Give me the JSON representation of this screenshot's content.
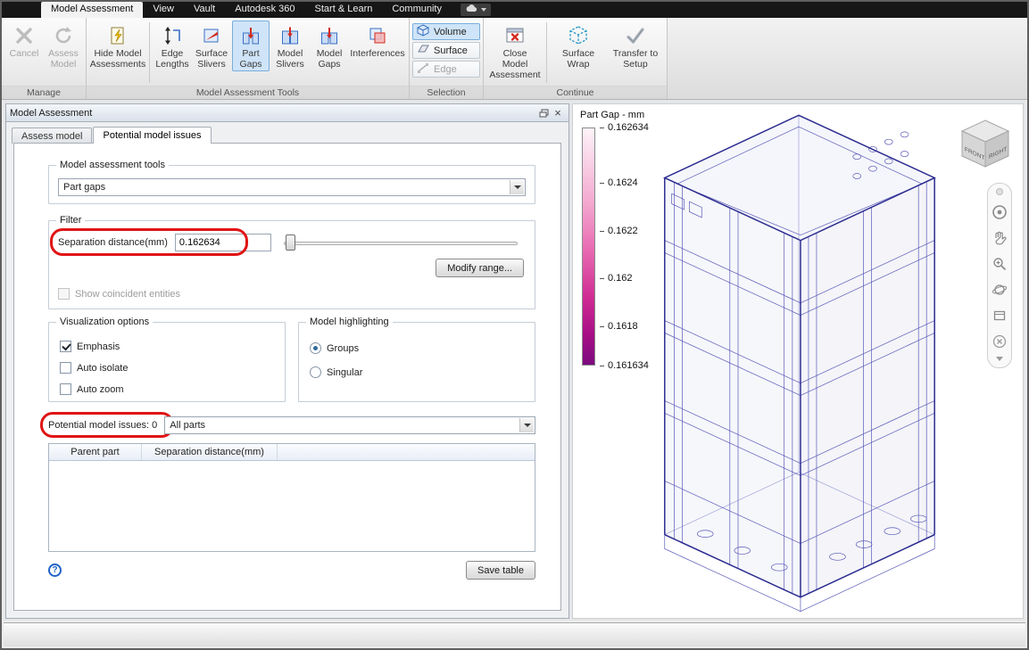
{
  "menubar": {
    "tabs": [
      "Model Assessment",
      "View",
      "Vault",
      "Autodesk 360",
      "Start & Learn",
      "Community"
    ]
  },
  "ribbon": {
    "group_labels": {
      "manage": "Manage",
      "tools": "Model Assessment Tools",
      "selection": "Selection",
      "continue": "Continue"
    },
    "buttons": {
      "cancel": "Cancel",
      "assess_model": "Assess Model",
      "hide_model_assessments": "Hide Model Assessments",
      "edge_lengths": "Edge Lengths",
      "surface_slivers": "Surface Slivers",
      "part_gaps": "Part Gaps",
      "model_slivers": "Model Slivers",
      "model_gaps": "Model Gaps",
      "interferences": "Interferences",
      "volume": "Volume",
      "surface": "Surface",
      "edge": "Edge",
      "close_model_assessment": "Close Model Assessment",
      "surface_wrap": "Surface Wrap",
      "transfer_to_setup": "Transfer to Setup"
    }
  },
  "panel": {
    "title": "Model Assessment",
    "tabs": [
      "Assess model",
      "Potential model issues"
    ],
    "tools": {
      "label": "Model assessment tools",
      "value": "Part gaps"
    },
    "filter": {
      "label": "Filter",
      "separation_label": "Separation distance(mm)",
      "separation_value": "0.162634",
      "modify_range_button": "Modify range...",
      "show_coincident_label": "Show coincident entities"
    },
    "visualization": {
      "label": "Visualization options",
      "options": [
        {
          "label": "Emphasis",
          "checked": true
        },
        {
          "label": "Auto isolate",
          "checked": false
        },
        {
          "label": "Auto zoom",
          "checked": false
        }
      ]
    },
    "highlighting": {
      "label": "Model highlighting",
      "options": [
        {
          "label": "Groups",
          "selected": true
        },
        {
          "label": "Singular",
          "selected": false
        }
      ]
    },
    "issues": {
      "label": "Potential model issues: 0",
      "dropdown_value": "All parts"
    },
    "table": {
      "headers": [
        "Parent part",
        "Separation distance(mm)"
      ]
    },
    "save_table_button": "Save table",
    "help_glyph": "?"
  },
  "viewport": {
    "legend": {
      "title": "Part Gap - mm",
      "ticks": [
        "0.162634",
        "0.1624",
        "0.1622",
        "0.162",
        "0.1618",
        "0.161634"
      ],
      "top_color": "#fdf3f8",
      "bottom_color": "#7c0a7e"
    },
    "viewcube": {
      "labels": [
        "FRONT",
        "RIGHT"
      ]
    }
  }
}
